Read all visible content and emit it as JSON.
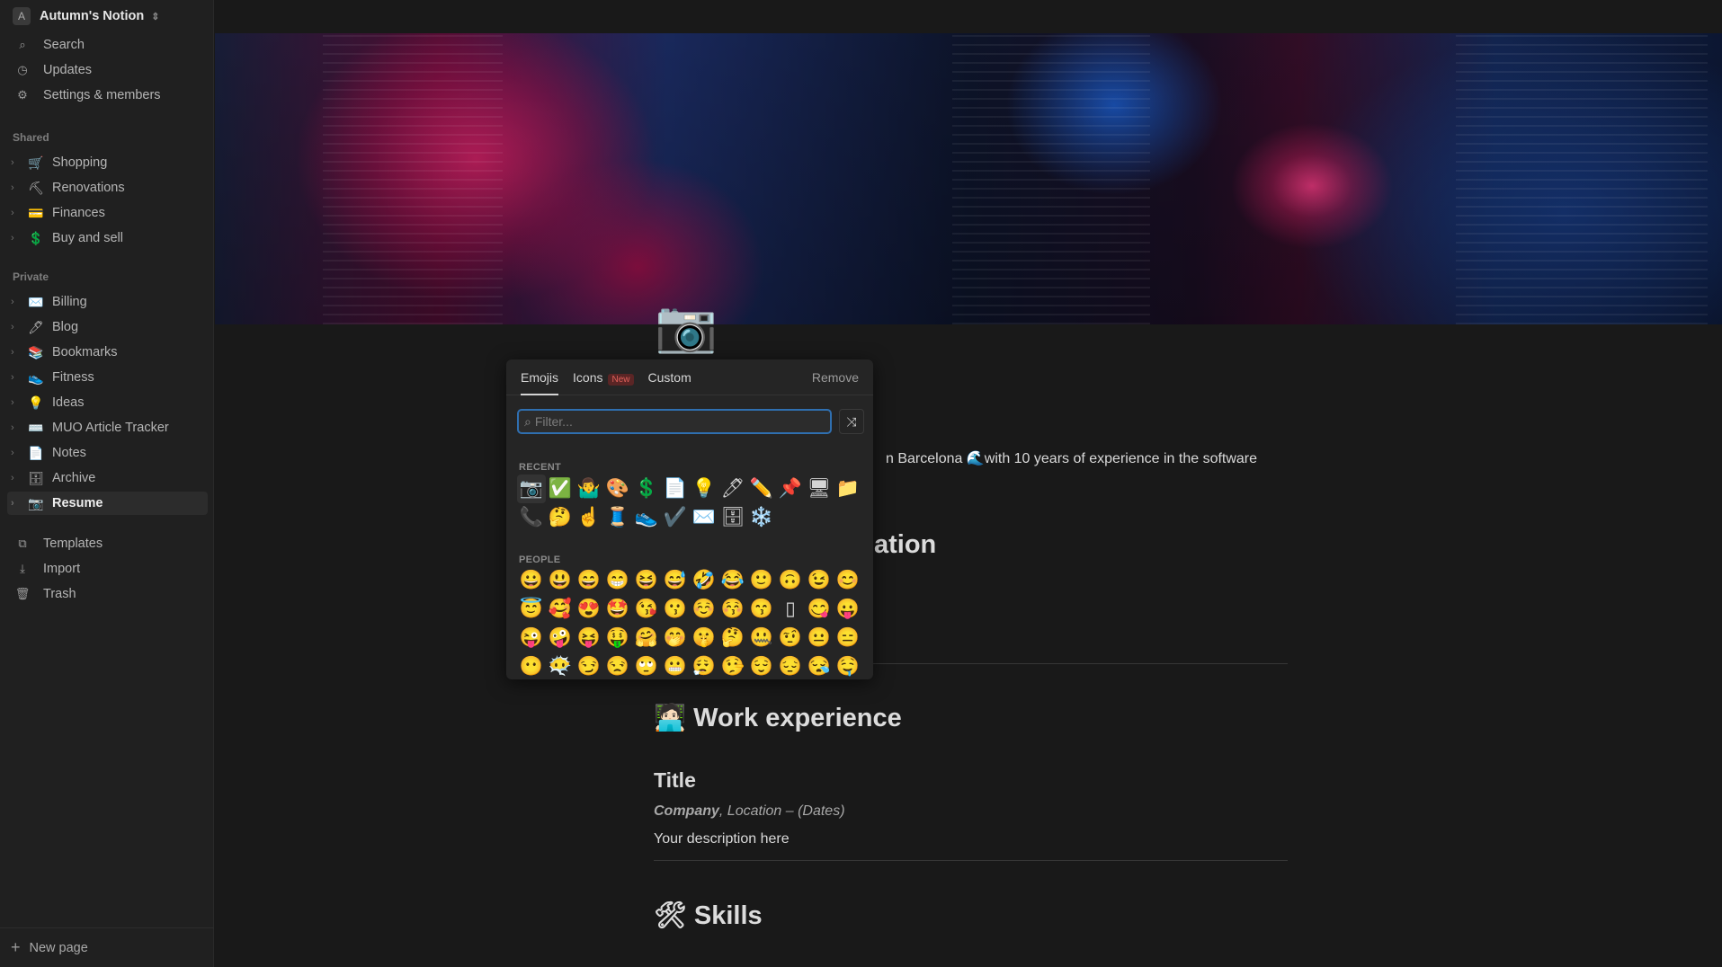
{
  "workspace": {
    "avatar": "A",
    "name": "Autumn's Notion"
  },
  "nav": [
    {
      "icon": "search-icon",
      "glyph": "⌕",
      "label": "Search"
    },
    {
      "icon": "clock-icon",
      "glyph": "◷",
      "label": "Updates"
    },
    {
      "icon": "gear-icon",
      "glyph": "⚙",
      "label": "Settings & members"
    }
  ],
  "shared_label": "Shared",
  "shared": [
    {
      "emoji": "🛒",
      "label": "Shopping"
    },
    {
      "emoji": "⛏",
      "label": "Renovations"
    },
    {
      "emoji": "💳",
      "label": "Finances"
    },
    {
      "emoji": "💲",
      "label": "Buy and sell"
    }
  ],
  "private_label": "Private",
  "private": [
    {
      "emoji": "✉️",
      "label": "Billing"
    },
    {
      "emoji": "🖊",
      "label": "Blog"
    },
    {
      "emoji": "📚",
      "label": "Bookmarks"
    },
    {
      "emoji": "👟",
      "label": "Fitness"
    },
    {
      "emoji": "💡",
      "label": "Ideas"
    },
    {
      "emoji": "⌨️",
      "label": "MUO Article Tracker"
    },
    {
      "emoji": "📄",
      "label": "Notes"
    },
    {
      "emoji": "🗄",
      "label": "Archive"
    },
    {
      "emoji": "📷",
      "label": "Resume",
      "active": true
    }
  ],
  "bottom": [
    {
      "icon": "templates-icon",
      "glyph": "⧉",
      "label": "Templates"
    },
    {
      "icon": "import-icon",
      "glyph": "⤓",
      "label": "Import"
    },
    {
      "icon": "trash-icon",
      "glyph": "🗑",
      "label": "Trash"
    }
  ],
  "new_page": "New page",
  "page": {
    "icon": "📷",
    "intro": "n Barcelona 🌊with 10 years of experience in the software",
    "heading_partial": "ation",
    "work_heading": "🧑🏻‍💻 Work experience",
    "title": "Title",
    "company": "Company",
    "location_dates": ", Location – (Dates)",
    "description": "Your description here",
    "skills_heading": "🛠 Skills"
  },
  "picker": {
    "tabs": [
      "Emojis",
      "Icons",
      "Custom"
    ],
    "new_badge": "New",
    "remove": "Remove",
    "filter_placeholder": "Filter...",
    "recent_label": "RECENT",
    "recent": [
      "📷",
      "✅",
      "🤷‍♂️",
      "🎨",
      "💲",
      "📄",
      "💡",
      "🖊",
      "✏️",
      "📌",
      "🖥",
      "📁",
      "📞",
      "🤔",
      "☝️",
      "🧵",
      "👟",
      "✔️",
      "✉️",
      "🗄",
      "❄️"
    ],
    "people_label": "PEOPLE",
    "people": [
      "😀",
      "😃",
      "😄",
      "😁",
      "😆",
      "😅",
      "🤣",
      "😂",
      "🙂",
      "🙃",
      "😉",
      "😊",
      "😇",
      "🥰",
      "😍",
      "🤩",
      "😘",
      "😗",
      "☺️",
      "😚",
      "😙",
      "▯",
      "😋",
      "😛",
      "😜",
      "🤪",
      "😝",
      "🤑",
      "🤗",
      "🤭",
      "🤫",
      "🤔",
      "🤐",
      "🤨",
      "😐",
      "😑",
      "😶",
      "😶‍🌫️",
      "😏",
      "😒",
      "🙄",
      "😬",
      "😮‍💨",
      "🤥",
      "😌",
      "😔",
      "😪",
      "🤤"
    ]
  },
  "colors": {
    "accent": "#2f6fb0",
    "badge": "#e0605a",
    "background": "#191919",
    "sidebar": "#202020"
  }
}
